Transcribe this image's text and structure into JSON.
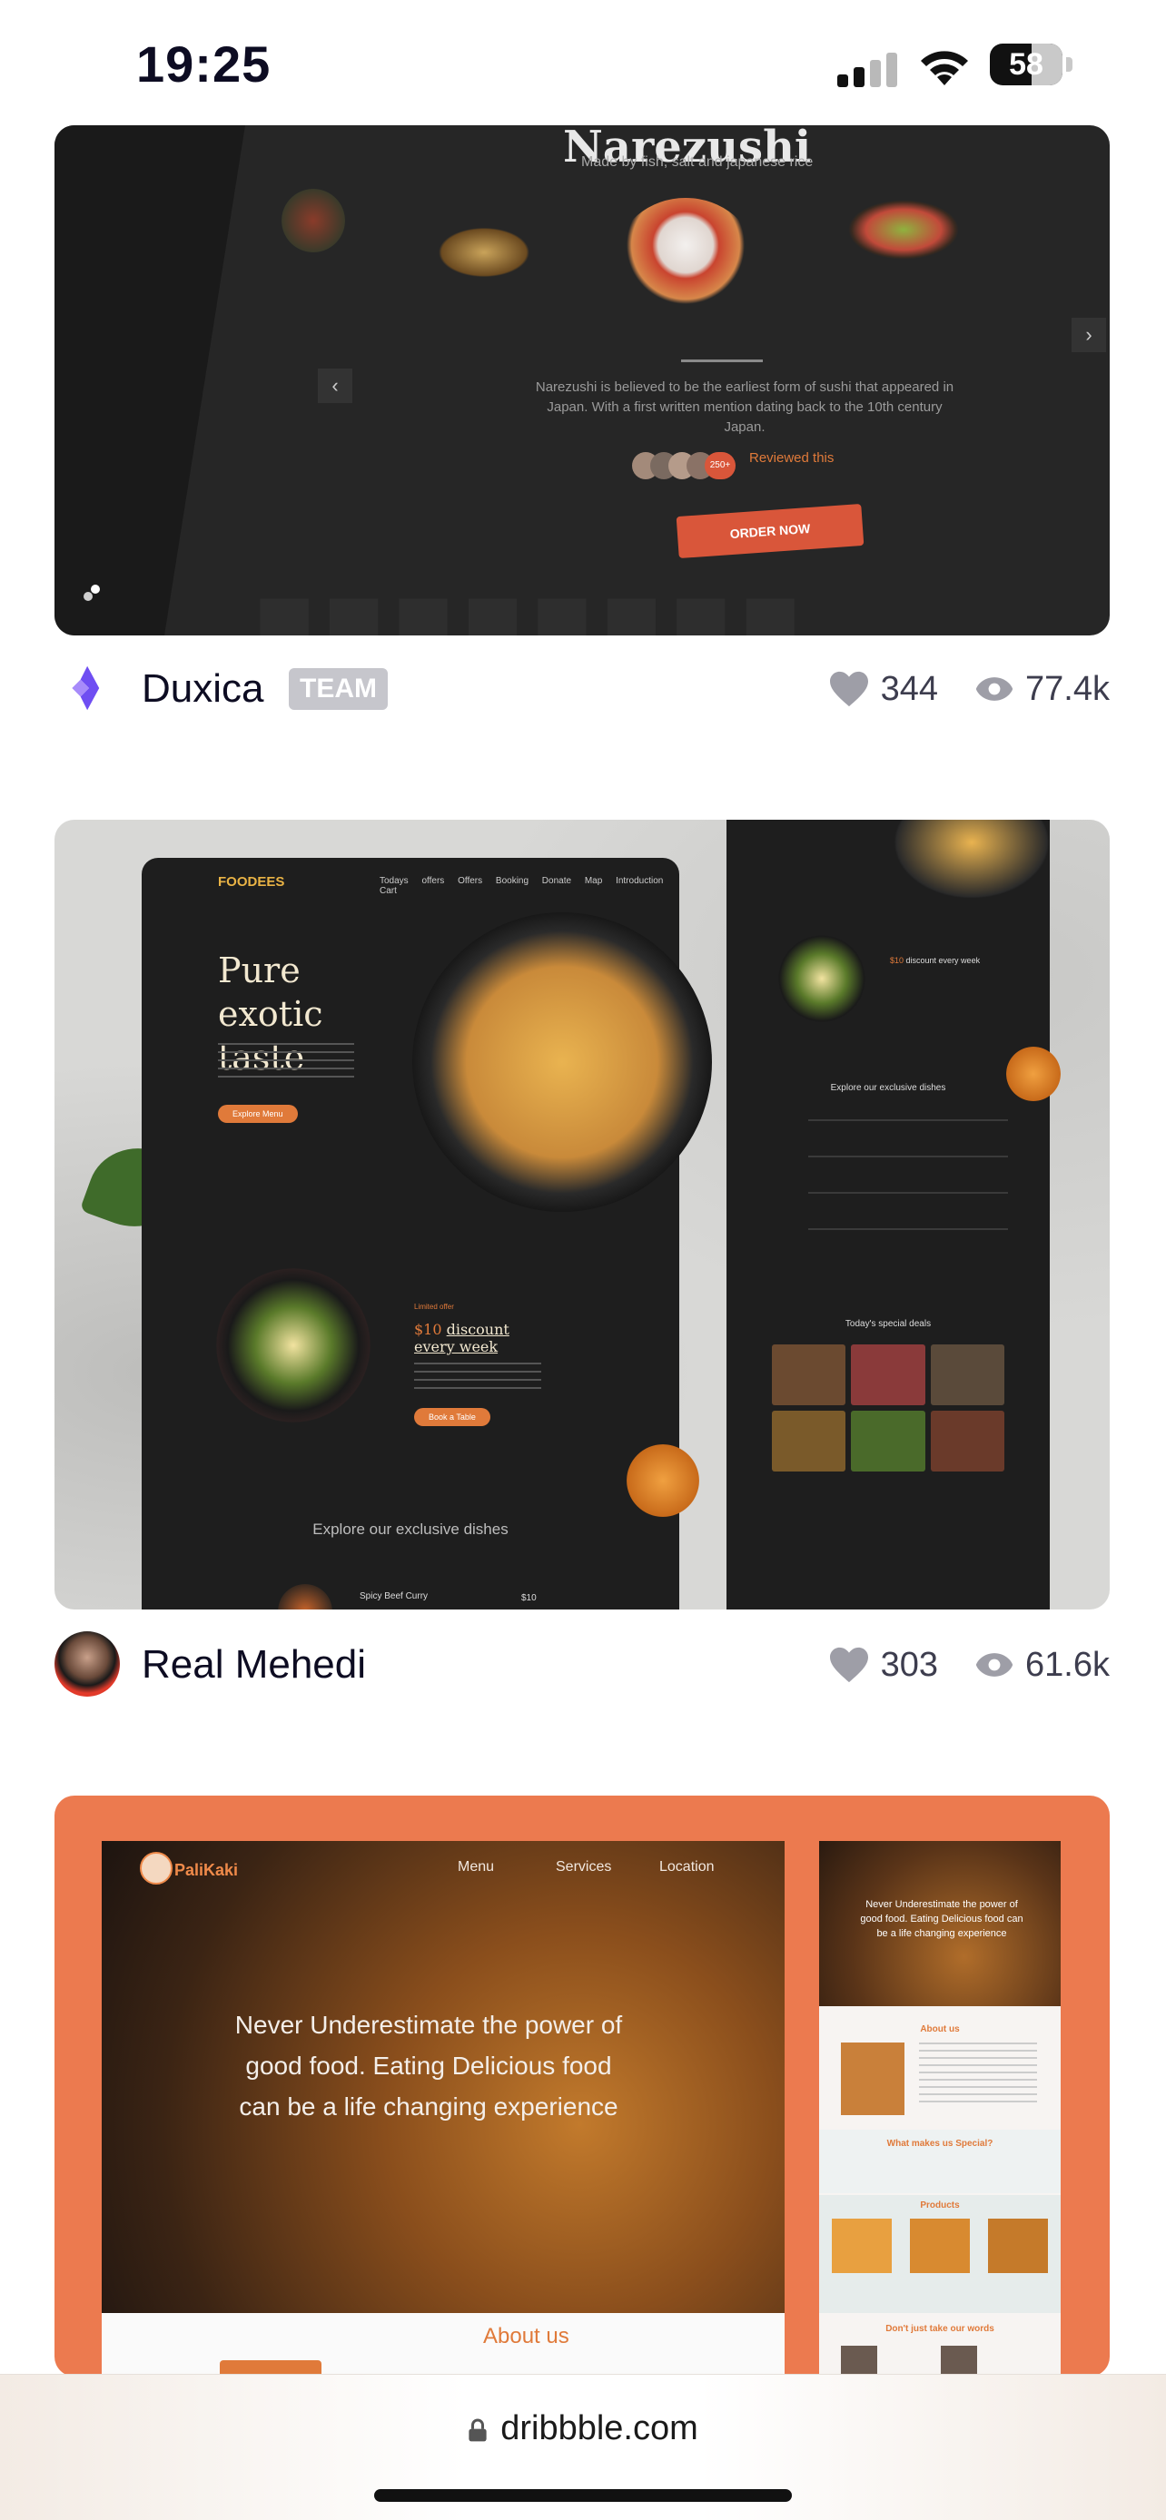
{
  "status_bar": {
    "time": "19:25",
    "battery": "58",
    "battery_fraction": 0.58
  },
  "shots": [
    {
      "title": "Narezushi",
      "subtitle": "Made by fish, salt and japanese rice",
      "description": "Narezushi is believed to be the earliest form of sushi that appeared in Japan. With a first written mention dating back to the 10th century Japan.",
      "review_count": "250+",
      "review_label": "Reviewed this",
      "cta": "ORDER NOW",
      "author": "Duxica",
      "badge": "TEAM",
      "likes": "344",
      "views": "77.4k"
    },
    {
      "logo": "FOODEES",
      "nav": "Todays offers Offers Booking Donate Map Introduction Cart",
      "headline": "Pure exotic taste",
      "hero_button": "Explore Menu",
      "offer_prefix": "$10",
      "offer_text": "discount every week",
      "offer_button": "Book a Table",
      "explore": "Explore our exclusive dishes",
      "item_name": "Spicy Beef Curry",
      "item_price": "$10",
      "right_explore": "Explore our exclusive dishes",
      "right_deals": "Today's special deals",
      "author": "Real Mehedi",
      "likes": "303",
      "views": "61.6k"
    },
    {
      "logo": "PaliKaki",
      "nav": [
        "Menu",
        "Services",
        "Location"
      ],
      "hero_text": "Never Underestimate the power of good food. Eating Delicious food can be a life changing experience",
      "about": "About us",
      "right_hero": "Never Underestimate the power of good food. Eating Delicious food can be a life changing experience",
      "right_about": "About us",
      "right_special": "What makes us Special?",
      "right_products": "Products",
      "right_words": "Don't just take our words"
    }
  ],
  "browser": {
    "url": "dribbble.com"
  },
  "colors": {
    "accent": "#ea4c89",
    "brand_orange": "#ec7a4f",
    "text": "#0d0c22"
  },
  "icons": [
    "heart-icon",
    "eye-icon",
    "lock-icon",
    "wifi-icon",
    "signal-icon",
    "battery-icon"
  ]
}
